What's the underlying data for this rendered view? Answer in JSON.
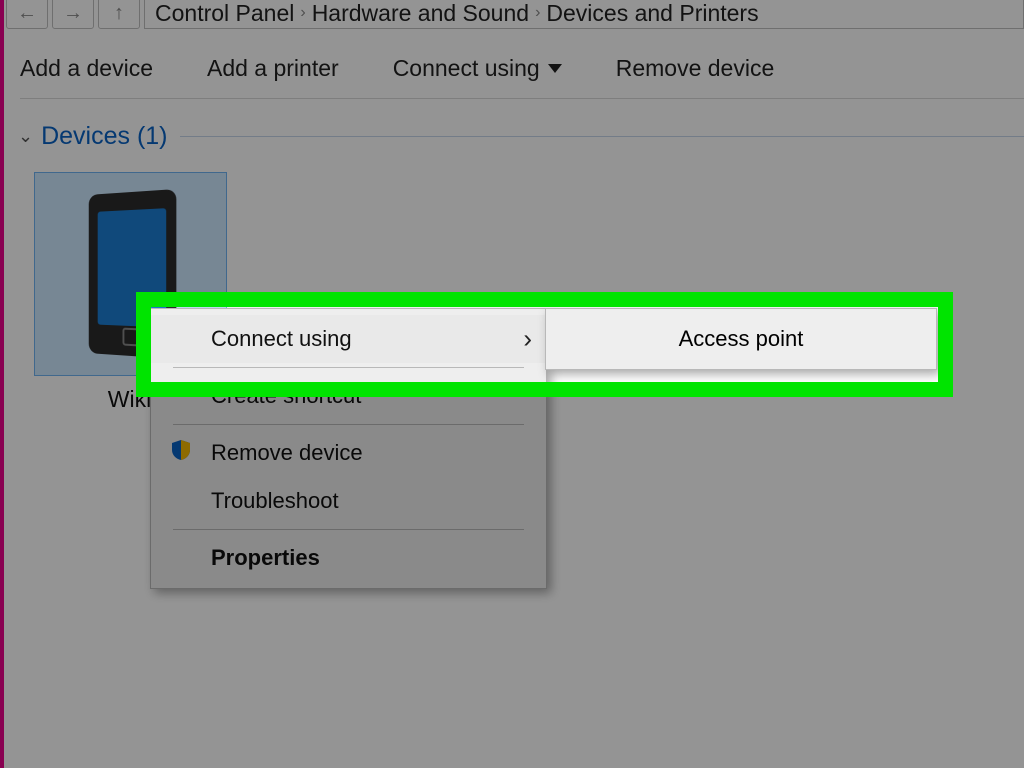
{
  "breadcrumb": {
    "part1": "Control Panel",
    "part2": "Hardware and Sound",
    "part3": "Devices and Printers"
  },
  "toolbar": {
    "add_device": "Add a device",
    "add_printer": "Add a printer",
    "connect_using": "Connect using",
    "remove_device": "Remove device"
  },
  "group": {
    "label": "Devices (1)"
  },
  "device": {
    "label": "Wiki"
  },
  "context_menu": {
    "connect_using": "Connect using",
    "create_shortcut": "Create shortcut",
    "remove_device": "Remove device",
    "troubleshoot": "Troubleshoot",
    "properties": "Properties"
  },
  "submenu": {
    "access_point": "Access point"
  }
}
